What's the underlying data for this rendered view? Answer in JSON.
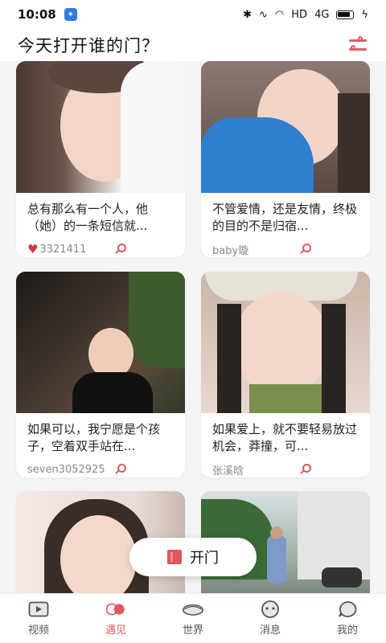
{
  "status_bar": {
    "time": "10:08",
    "network_label": "HD",
    "signal_label": "4G"
  },
  "header": {
    "title": "今天打开谁的门？"
  },
  "cards": [
    {
      "desc": "总有那么有一个人，他（她）的一条短信就...",
      "author": "3321411",
      "has_heart": true
    },
    {
      "desc": "不管爱情，还是友情，终极的目的不是归宿...",
      "author": "baby璇",
      "has_heart": false
    },
    {
      "desc": "如果可以，我宁愿是个孩子，空着双手站在...",
      "author": "seven3052925",
      "has_heart": false
    },
    {
      "desc": "如果爱上，就不要轻易放过机会，莽撞，可...",
      "author": "张溪晗",
      "has_heart": false
    }
  ],
  "floating_button": {
    "label": "开门"
  },
  "tabs": [
    {
      "label": "视频",
      "icon": "video-icon",
      "active": false
    },
    {
      "label": "遇见",
      "icon": "meet-icon",
      "active": true
    },
    {
      "label": "世界",
      "icon": "world-icon",
      "active": false
    },
    {
      "label": "消息",
      "icon": "message-icon",
      "active": false
    },
    {
      "label": "我的",
      "icon": "profile-icon",
      "active": false
    }
  ],
  "colors": {
    "accent": "#e05a63",
    "heart": "#d63a42",
    "background": "#f4f4f4"
  }
}
